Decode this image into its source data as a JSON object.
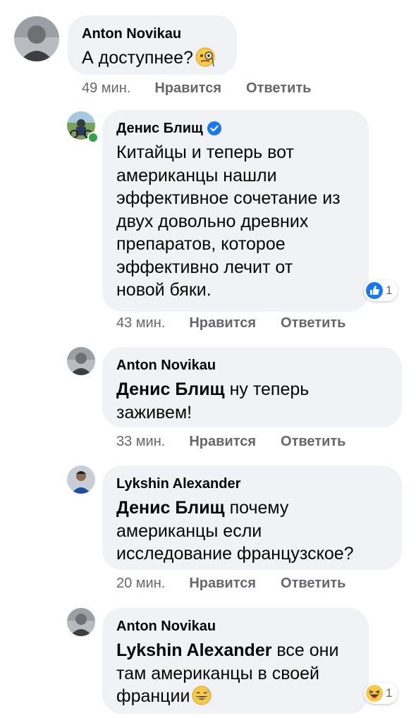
{
  "comments": [
    {
      "author": "Anton Novikau",
      "text": "А доступнее?",
      "emoji": "face-with-monocle",
      "time": "49 мин.",
      "like_label": "Нравится",
      "reply_label": "Ответить"
    },
    {
      "author": "Денис Блищ",
      "verified": true,
      "online": true,
      "text_lines": [
        "Китайцы и теперь вот",
        "американцы нашли",
        "эффективное сочетание из",
        "двух довольно древних",
        "препаратов, которое",
        "эффективно лечит от",
        "новой бяки."
      ],
      "reaction_count": "1",
      "reaction_icon": "like-icon",
      "time": "43 мин.",
      "like_label": "Нравится",
      "reply_label": "Ответить"
    },
    {
      "author": "Anton Novikau",
      "mention": "Денис Блищ",
      "text_line1": " ну теперь",
      "text_line2": "заживем!",
      "time": "33 мин.",
      "like_label": "Нравится",
      "reply_label": "Ответить"
    },
    {
      "author": "Lykshin Alexander",
      "mention": "Денис Блищ",
      "text_line1": " почему",
      "text_line2": "американцы если",
      "text_line3": "исследование французское?",
      "time": "20 мин.",
      "like_label": "Нравится",
      "reply_label": "Ответить"
    },
    {
      "author": "Anton Novikau",
      "mention": "Lykshin Alexander",
      "text_line1": " все они",
      "text_line2": "там американцы в своей",
      "text_line3": "франции",
      "emoji": "grinning-sweat",
      "reaction_count": "1",
      "reaction_icon": "haha-icon"
    }
  ],
  "colors": {
    "bubble": "#f0f2f5",
    "meta": "#65676b",
    "text": "#050505",
    "like_blue": "#1877f2",
    "online": "#31a24c",
    "haha_yellow": "#f7c94a"
  }
}
